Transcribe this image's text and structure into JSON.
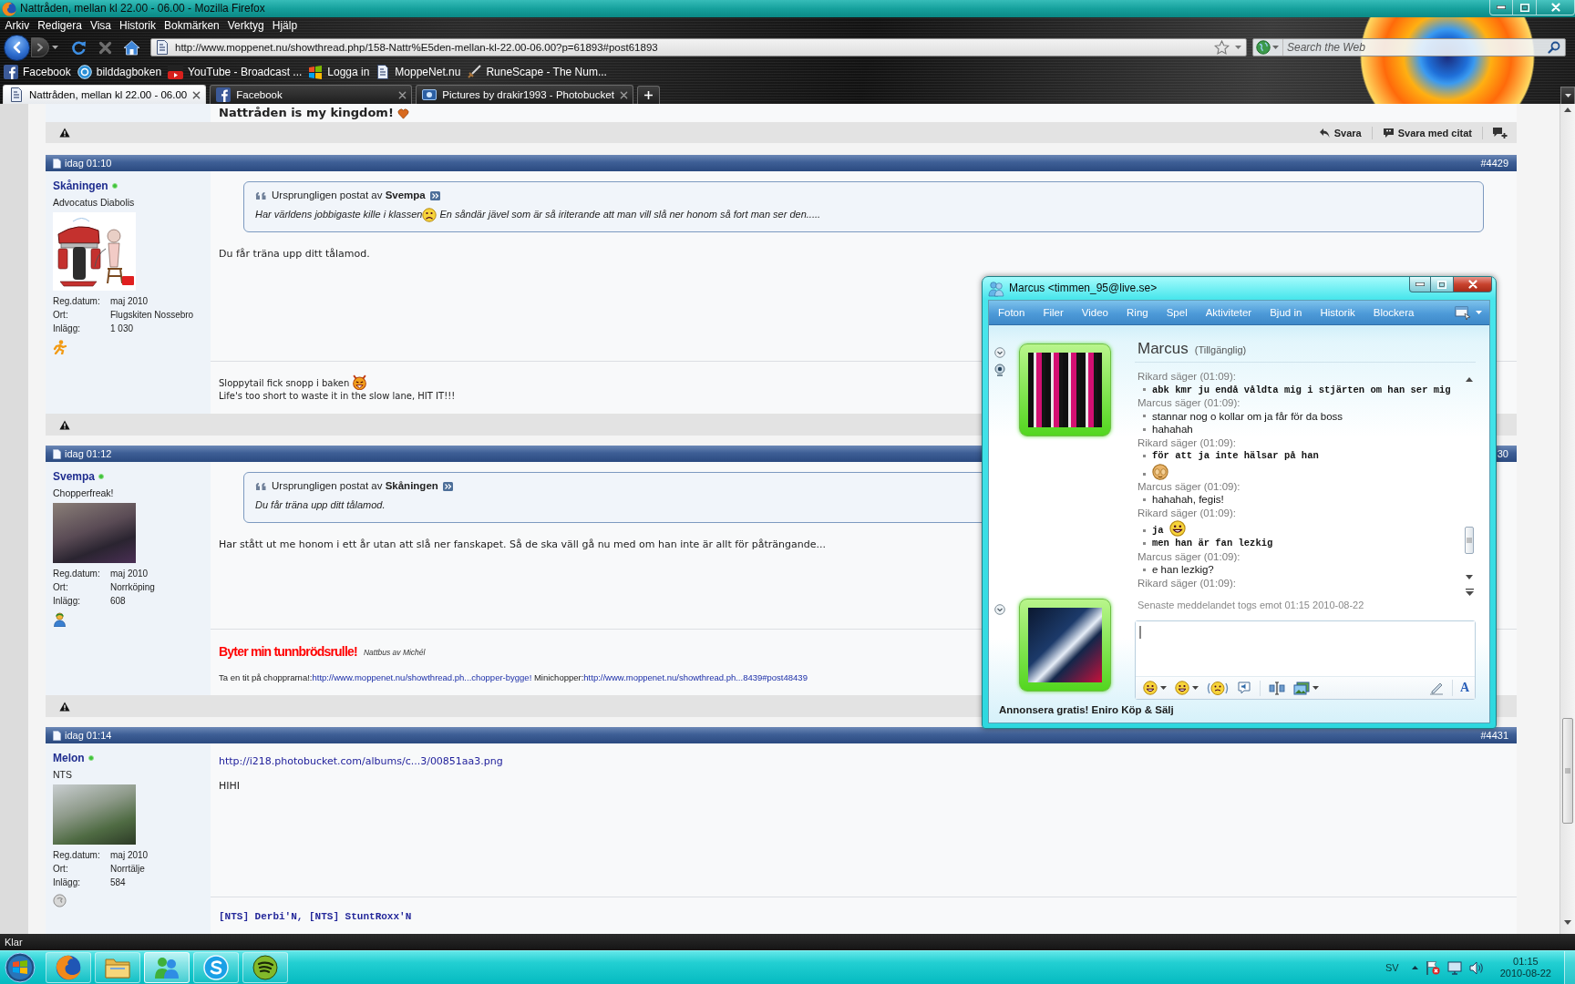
{
  "window": {
    "title": "Nattråden, mellan kl 22.00 - 06.00 - Mozilla Firefox"
  },
  "menu": [
    "Arkiv",
    "Redigera",
    "Visa",
    "Historik",
    "Bokmärken",
    "Verktyg",
    "Hjälp"
  ],
  "navigation": {
    "url": "http://www.moppenet.nu/showthread.php/158-Nattr%E5den-mellan-kl-22.00-06.00?p=61893#post61893",
    "search_placeholder": "Search the Web"
  },
  "bookmarks": [
    {
      "label": "Facebook",
      "kind": "tile"
    },
    {
      "label": "bilddagboken",
      "kind": "bubble"
    },
    {
      "label": "YouTube - Broadcast ...",
      "kind": "tv"
    },
    {
      "label": "Logga in",
      "kind": "flag"
    },
    {
      "label": "MoppeNet.nu",
      "kind": "page"
    },
    {
      "label": "RuneScape - The Num...",
      "kind": "sword"
    }
  ],
  "tabs": [
    {
      "label": "Nattråden, mellan kl 22.00 - 06.00",
      "selected": true,
      "kind": "page"
    },
    {
      "label": "Facebook",
      "selected": false,
      "kind": "tile"
    },
    {
      "label": "Pictures by drakir1993 - Photobucket",
      "selected": false,
      "kind": "photo"
    }
  ],
  "forum": {
    "previous_post": {
      "signature": "Nattråden is my kingdom!",
      "actions": [
        {
          "label": "Svara",
          "kind": "reply"
        },
        {
          "label": "Svara med citat",
          "kind": "quote"
        }
      ]
    },
    "posts": [
      {
        "time": "idag 01:10",
        "number": "#4429",
        "user": {
          "name": "Skåningen",
          "online": true,
          "title": "Advocatus Diabolis",
          "avatar": {
            "kind": "cartoon"
          },
          "details": [
            {
              "label": "Reg.datum:",
              "value": "maj 2010"
            },
            {
              "label": "Ort:",
              "value": "Flugskiten Nossebro"
            },
            {
              "label": "Inlägg:",
              "value": "1 030"
            }
          ],
          "contact_icon": {
            "kind": "runner"
          }
        },
        "quote": {
          "header": "Ursprungligen postat av **Svempa**",
          "parts": [
            {
              "kind": "text",
              "text": "Har världens jobbigaste kille i klassen"
            },
            {
              "kind": "frown"
            },
            {
              "kind": "text",
              "text": " En såndär jävel som är så iriterande att man vill slå ner honom så fort man ser den....."
            }
          ]
        },
        "message": [
          {
            "kind": "text",
            "text": "Du får träna upp ditt tålamod."
          }
        ],
        "signature": [
          {
            "kind": "text",
            "text": "Sloppytail fick snopp i baken",
            "emoticon": true
          },
          {
            "kind": "text",
            "text": "Life's too short to waste it in the slow lane, HIT IT!!!",
            "emoticon": false
          }
        ]
      },
      {
        "time": "idag 01:12",
        "number": "30",
        "user": {
          "name": "Svempa",
          "online": true,
          "title": "Chopperfreak!",
          "avatar": {
            "kind": "portrait"
          },
          "details": [
            {
              "label": "Reg.datum:",
              "value": "maj 2010"
            },
            {
              "label": "Ort:",
              "value": "Norrköping"
            },
            {
              "label": "Inlägg:",
              "value": "608"
            }
          ],
          "contact_icon": {
            "kind": "buddy"
          }
        },
        "quote": {
          "header": "Ursprungligen postat av **Skåningen**",
          "parts": [
            {
              "kind": "text",
              "text": "Du får träna upp ditt tålamod."
            }
          ]
        },
        "message": [
          {
            "kind": "text",
            "text": "Har stått ut me honom i ett år utan att slå ner fanskapet. Så de ska väll gå nu med om han inte är allt för påträngande..."
          }
        ],
        "signature": [
          {
            "kind": "banner",
            "text": "Byter min tunnbrödsrulle!",
            "caption": "Nattbus av Michél"
          },
          {
            "kind": "links",
            "parts": [
              {
                "kind": "text",
                "text": "Ta en tit på chopprarna!:"
              },
              {
                "kind": "link",
                "text": "http://www.moppenet.nu/showthread.ph...chopper-bygge!"
              },
              {
                "kind": "text",
                "text": " Minichopper:"
              },
              {
                "kind": "link",
                "text": "http://www.moppenet.nu/showthread.ph...8439#post48439"
              }
            ]
          }
        ]
      },
      {
        "time": "idag 01:14",
        "number": "#4431",
        "user": {
          "name": "Melon",
          "online": true,
          "title": "NTS",
          "avatar": {
            "kind": "bike"
          },
          "details": [
            {
              "label": "Reg.datum:",
              "value": "maj 2010"
            },
            {
              "label": "Ort:",
              "value": "Norrtälje"
            },
            {
              "label": "Inlägg:",
              "value": "584"
            }
          ],
          "contact_icon": {
            "kind": "bubble"
          }
        },
        "message": [
          {
            "kind": "link",
            "text": "http://i218.photobucket.com/albums/c...3/00851aa3.png"
          },
          {
            "kind": "text",
            "text": "HIHI"
          }
        ],
        "signature": [
          {
            "kind": "mono",
            "text": "[NTS] Derbi'N, [NTS] StuntRoxx'N"
          }
        ]
      }
    ]
  },
  "messenger": {
    "title": "Marcus <timmen_95@live.se>",
    "toolbar": [
      "Foton",
      "Filer",
      "Video",
      "Ring",
      "Spel",
      "Aktiviteter",
      "Bjud in",
      "Historik",
      "Blockera"
    ],
    "contact": {
      "name": "Marcus",
      "status": "(Tillgänglig)"
    },
    "log": [
      {
        "sender": "Rikard säger (01:09):",
        "kind": "mono",
        "lines": [
          {
            "kind": "text",
            "text": "abk kmr ju endå våldta mig i stjärten om han ser mig",
            "smiley": false
          }
        ]
      },
      {
        "sender": "Marcus säger (01:09):",
        "kind": "plain",
        "lines": [
          {
            "kind": "text",
            "text": "stannar nog o kollar om ja får för da boss",
            "smiley": false
          },
          {
            "kind": "text",
            "text": "hahahah",
            "smiley": false
          }
        ]
      },
      {
        "sender": "Rikard säger (01:09):",
        "kind": "mono",
        "lines": [
          {
            "kind": "text",
            "text": "för att ja inte hälsar på han",
            "smiley": false
          },
          {
            "kind": "emoticon"
          }
        ]
      },
      {
        "sender": "Marcus säger (01:09):",
        "kind": "plain",
        "lines": [
          {
            "kind": "text",
            "text": "hahahah, fegis!",
            "smiley": false
          }
        ]
      },
      {
        "sender": "Rikard säger (01:09):",
        "kind": "mono",
        "lines": [
          {
            "kind": "text",
            "text": "ja",
            "smiley": true
          },
          {
            "kind": "text",
            "text": "men han är fan lezkig",
            "smiley": false
          }
        ]
      },
      {
        "sender": "Marcus säger (01:09):",
        "kind": "plain",
        "lines": [
          {
            "kind": "text",
            "text": "e han lezkig?",
            "smiley": false
          }
        ]
      },
      {
        "sender": "Rikard säger (01:09):"
      }
    ],
    "last_received": "Senaste meddelandet togs emot 01:15 2010-08-22",
    "font_button": "A",
    "ad": "Annonsera gratis! Eniro Köp & Sälj"
  },
  "status_bar": {
    "text": "Klar"
  },
  "taskbar": {
    "apps": [
      {
        "kind": "browser",
        "selected": false
      },
      {
        "kind": "folder",
        "selected": false
      },
      {
        "kind": "messenger",
        "selected": true
      },
      {
        "kind": "cloud",
        "selected": false
      },
      {
        "kind": "music",
        "selected": false
      }
    ],
    "language": "SV",
    "time": "01:15",
    "date": "2010-08-22"
  }
}
